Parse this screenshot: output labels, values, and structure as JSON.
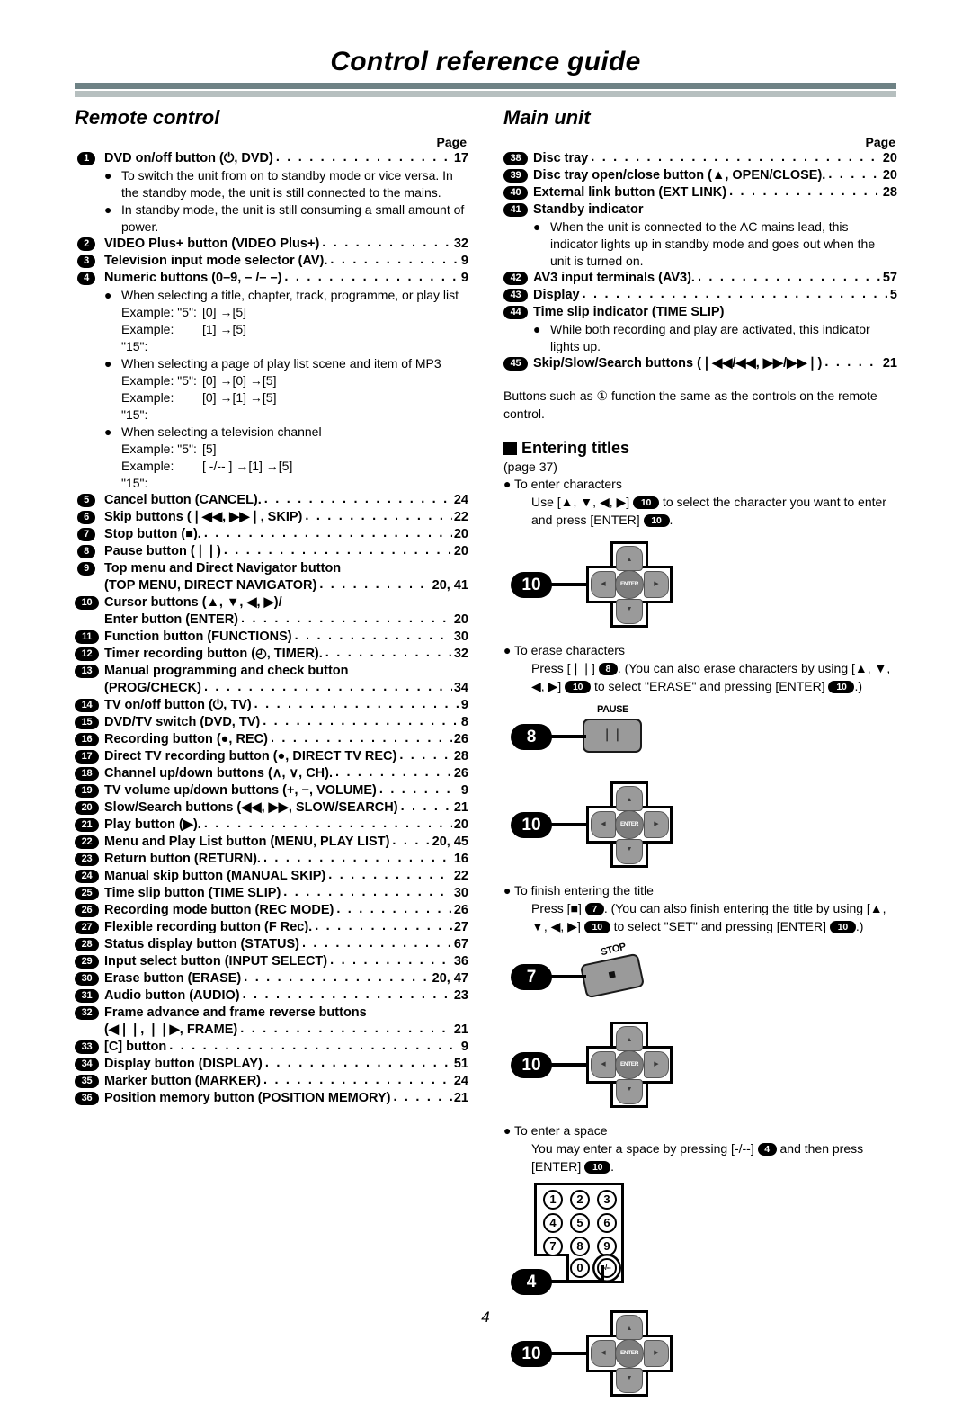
{
  "header": {
    "title": "Control reference guide"
  },
  "page_number": "4",
  "left": {
    "section_title": "Remote control",
    "page_label": "Page",
    "entries": [
      {
        "num": "1",
        "text": "DVD on/off button (⏻, DVD)",
        "page": "17",
        "bullets": [
          "To switch the unit from on to standby mode or vice versa. In the standby mode, the unit is still connected to the mains.",
          "In standby mode, the unit is still consuming a small amount of power."
        ]
      },
      {
        "num": "2",
        "text": "VIDEO Plus+ button (VIDEO Plus+)",
        "page": "32"
      },
      {
        "num": "3",
        "text": "Television input mode selector (AV).",
        "page": "9"
      },
      {
        "num": "4",
        "text": "Numeric buttons (0–9, – /– –)",
        "page": "9",
        "groups": [
          {
            "bullet": "When selecting a title, chapter, track, programme, or play list",
            "examples": [
              {
                "label": "Example: \"5\":",
                "value": "[0] →[5]"
              },
              {
                "label": "Example: \"15\":",
                "value": "[1] →[5]"
              }
            ]
          },
          {
            "bullet": "When selecting a page of play list scene and item of MP3",
            "examples": [
              {
                "label": "Example: \"5\":",
                "value": "[0] →[0] →[5]"
              },
              {
                "label": "Example: \"15\":",
                "value": "[0] →[1] →[5]"
              }
            ]
          },
          {
            "bullet": "When selecting a television channel",
            "examples": [
              {
                "label": "Example: \"5\":",
                "value": "[5]"
              },
              {
                "label": "Example: \"15\":",
                "value": "[ -/-- ] →[1] →[5]"
              }
            ]
          }
        ]
      },
      {
        "num": "5",
        "text": "Cancel button (CANCEL).",
        "page": "24"
      },
      {
        "num": "6",
        "text": "Skip buttons (❘◀◀, ▶▶❘, SKIP)",
        "page": "22"
      },
      {
        "num": "7",
        "text": "Stop button (■).",
        "page": "20"
      },
      {
        "num": "8",
        "text": "Pause button (❘❘)",
        "page": "20"
      },
      {
        "num": "9",
        "text": "Top menu and Direct Navigator button",
        "cont": "(TOP MENU, DIRECT NAVIGATOR)",
        "page": "20, 41"
      },
      {
        "num": "10",
        "text": "Cursor buttons (▲, ▼, ◀, ▶)/",
        "cont": "Enter button (ENTER)",
        "page": "20"
      },
      {
        "num": "11",
        "text": "Function button (FUNCTIONS)",
        "page": "30"
      },
      {
        "num": "12",
        "text": "Timer recording button (◴, TIMER).",
        "page": "32"
      },
      {
        "num": "13",
        "text": "Manual programming and check button",
        "cont": "(PROG/CHECK)",
        "page": "34"
      },
      {
        "num": "14",
        "text": "TV on/off button (⏻, TV)",
        "page": "9"
      },
      {
        "num": "15",
        "text": "DVD/TV switch (DVD, TV)",
        "page": "8"
      },
      {
        "num": "16",
        "text": "Recording button (●, REC)",
        "page": "26"
      },
      {
        "num": "17",
        "text": "Direct TV recording button (●, DIRECT TV REC)",
        "page": "28"
      },
      {
        "num": "18",
        "text": "Channel up/down buttons (∧, ∨, CH).",
        "page": "26"
      },
      {
        "num": "19",
        "text": "TV volume up/down buttons (+, −, VOLUME)",
        "page": "9"
      },
      {
        "num": "20",
        "text": "Slow/Search buttons (◀◀, ▶▶, SLOW/SEARCH)",
        "page": "21"
      },
      {
        "num": "21",
        "text": "Play button (▶).",
        "page": "20"
      },
      {
        "num": "22",
        "text": "Menu and Play List button (MENU, PLAY LIST)",
        "page": "20, 45"
      },
      {
        "num": "23",
        "text": "Return button (RETURN).",
        "page": "16"
      },
      {
        "num": "24",
        "text": "Manual skip button (MANUAL SKIP)",
        "page": "22"
      },
      {
        "num": "25",
        "text": "Time slip button (TIME SLIP)",
        "page": "30"
      },
      {
        "num": "26",
        "text": "Recording mode button (REC MODE)",
        "page": "26"
      },
      {
        "num": "27",
        "text": "Flexible recording button (F Rec).",
        "page": "27"
      },
      {
        "num": "28",
        "text": "Status display button (STATUS)",
        "page": "67"
      },
      {
        "num": "29",
        "text": "Input select button (INPUT SELECT)",
        "page": "36"
      },
      {
        "num": "30",
        "text": "Erase button (ERASE)",
        "page": "20, 47"
      },
      {
        "num": "31",
        "text": "Audio button (AUDIO)",
        "page": "23"
      },
      {
        "num": "32",
        "text": "Frame advance and frame reverse buttons",
        "cont": "(◀❘❘, ❘❘▶, FRAME)",
        "page": "21"
      },
      {
        "num": "33",
        "text": "[C] button",
        "page": "9"
      },
      {
        "num": "34",
        "text": "Display button (DISPLAY)",
        "page": "51"
      },
      {
        "num": "35",
        "text": "Marker button (MARKER)",
        "page": "24"
      },
      {
        "num": "36",
        "text": "Position memory button (POSITION MEMORY)",
        "page": "21"
      }
    ]
  },
  "right": {
    "section_title": "Main unit",
    "page_label": "Page",
    "entries": [
      {
        "num": "38",
        "text": "Disc tray",
        "page": "20"
      },
      {
        "num": "39",
        "text": "Disc tray open/close button (▲, OPEN/CLOSE).",
        "page": "20"
      },
      {
        "num": "40",
        "text": "External link button (EXT LINK)",
        "page": "28"
      },
      {
        "num": "41",
        "text": "Standby indicator",
        "bullets": [
          "When the unit is connected to the AC mains lead, this indicator lights up in standby mode and goes out when the unit is turned on."
        ]
      },
      {
        "num": "42",
        "text": "AV3 input terminals (AV3).",
        "page": "57"
      },
      {
        "num": "43",
        "text": "Display",
        "page": "5"
      },
      {
        "num": "44",
        "text": "Time slip indicator (TIME SLIP)",
        "bullets": [
          "While both recording and play are activated, this indicator lights up."
        ]
      },
      {
        "num": "45",
        "text": "Skip/Slow/Search buttons (❘◀◀/◀◀, ▶▶/▶▶❘)",
        "page": "21"
      }
    ],
    "note": "Buttons such as ① function the same as the controls on the remote control.",
    "entering_titles": {
      "heading": "Entering titles",
      "page_ref": "(page 37)",
      "steps": [
        {
          "bullet": "To enter characters",
          "body_parts": [
            {
              "t": "text",
              "v": "Use [▲, ▼, ◀, ▶] "
            },
            {
              "t": "badge",
              "v": "10"
            },
            {
              "t": "text",
              "v": " to select the character you want to enter and press [ENTER] "
            },
            {
              "t": "badge",
              "v": "10"
            },
            {
              "t": "text",
              "v": "."
            }
          ],
          "diagram": "cursor-pad",
          "diagram_badge": "10"
        },
        {
          "bullet": "To erase characters",
          "body_parts": [
            {
              "t": "text",
              "v": "Press [❘❘] "
            },
            {
              "t": "badge",
              "v": "8"
            },
            {
              "t": "text",
              "v": ". (You can also erase characters by using [▲, ▼, ◀, ▶] "
            },
            {
              "t": "badge",
              "v": "10"
            },
            {
              "t": "text",
              "v": " to select \"ERASE\" and pressing [ENTER] "
            },
            {
              "t": "badge",
              "v": "10"
            },
            {
              "t": "text",
              "v": ".)"
            }
          ],
          "diagram": "pause-key-and-pad",
          "key_label": "PAUSE",
          "key_badge": "8",
          "diagram_badge": "10"
        },
        {
          "bullet": "To finish entering the title",
          "body_parts": [
            {
              "t": "text",
              "v": "Press [■] "
            },
            {
              "t": "badge",
              "v": "7"
            },
            {
              "t": "text",
              "v": ". (You can also finish entering the title by using [▲, ▼, ◀, ▶] "
            },
            {
              "t": "badge",
              "v": "10"
            },
            {
              "t": "text",
              "v": " to select \"SET\" and pressing [ENTER] "
            },
            {
              "t": "badge",
              "v": "10"
            },
            {
              "t": "text",
              "v": ".)"
            }
          ],
          "diagram": "stop-key-and-pad",
          "key_label": "STOP",
          "key_badge": "7",
          "diagram_badge": "10"
        },
        {
          "bullet": "To enter a space",
          "body_parts": [
            {
              "t": "text",
              "v": "You may enter a space by pressing [-/--] "
            },
            {
              "t": "badge",
              "v": "4"
            },
            {
              "t": "text",
              "v": " and then press [ENTER] "
            },
            {
              "t": "badge",
              "v": "10"
            },
            {
              "t": "text",
              "v": "."
            }
          ],
          "diagram": "numeric-keypad-and-pad",
          "key_badge": "4",
          "diagram_badge": "10"
        }
      ],
      "keypad_keys": [
        "1",
        "2",
        "3",
        "4",
        "5",
        "6",
        "7",
        "8",
        "9",
        "0",
        "-/--"
      ],
      "cursor_pad": {
        "up": "▲",
        "down": "▼",
        "left": "◀",
        "right": "▶",
        "enter": "ENTER"
      },
      "pause_glyph": "❘❘",
      "stop_glyph": "■"
    }
  },
  "colors": {
    "rule_dark": "#6e8285",
    "rule_light": "#b6bfbf",
    "badge_bg": "#000000",
    "key_gray": "#9a9a9a"
  }
}
